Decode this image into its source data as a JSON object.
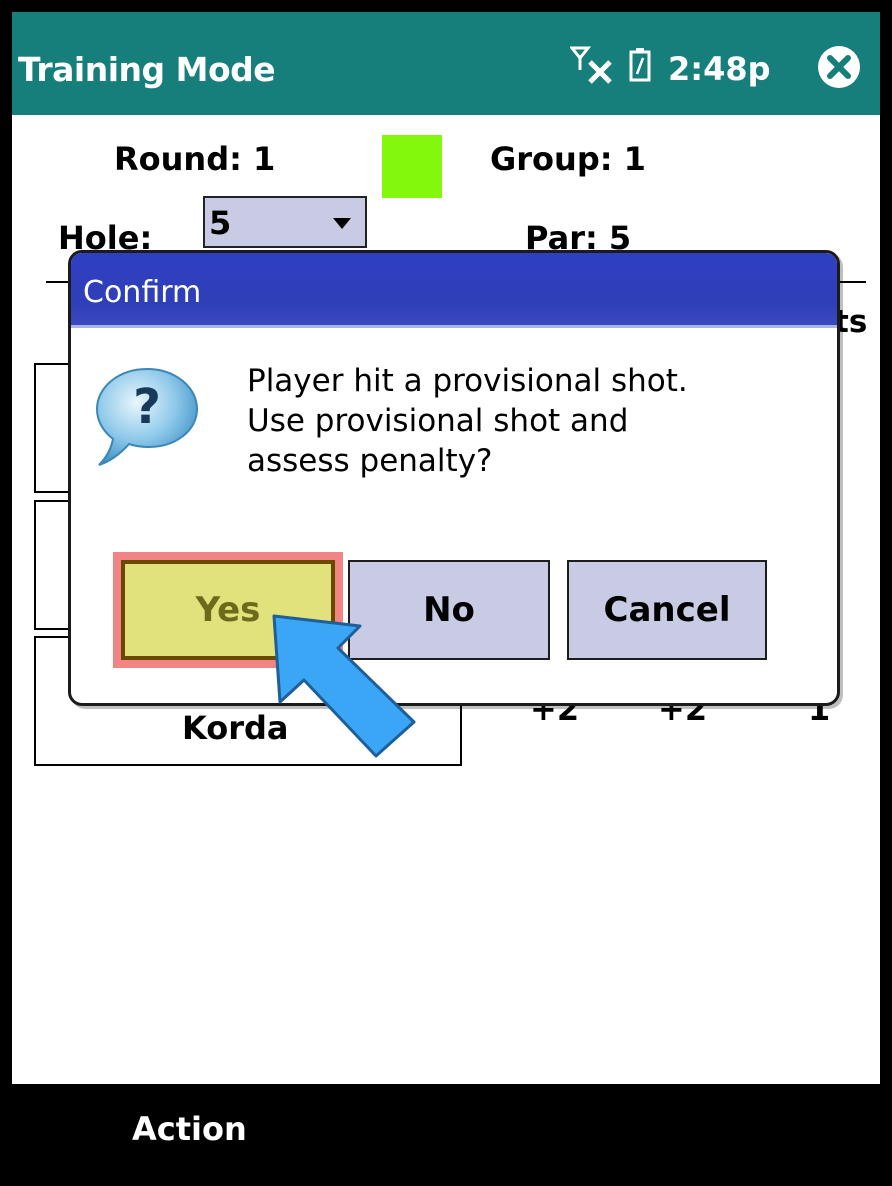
{
  "status_bar": {
    "title": "Training Mode",
    "time": "2:48p",
    "signal_icon": "signal-off-icon",
    "battery_icon": "battery-icon",
    "close_icon": "close-icon"
  },
  "header": {
    "round_label": "Round:  1",
    "group_label": "Group:  1",
    "hole_label": "Hole:",
    "hole_value": "5",
    "par_label": "Par:  5",
    "indicator_color": "#84f80c"
  },
  "table": {
    "pts_fragment": "ts",
    "players": [
      {
        "name": "Korda",
        "scores": [
          "+2",
          "+2",
          "1"
        ]
      }
    ]
  },
  "dialog": {
    "title": "Confirm",
    "icon": "question-icon",
    "message_lines": [
      "Player hit a provisional shot.",
      "Use provisional shot and",
      "assess penalty?"
    ],
    "buttons": {
      "yes": "Yes",
      "no": "No",
      "cancel": "Cancel"
    }
  },
  "footer": {
    "action_label": "Action"
  },
  "colors": {
    "title_bar": "#177f7b",
    "dialog_header": "#2f3fc3",
    "yes_button": "#e2e27c",
    "yes_highlight": "#f18585",
    "button_default": "#c9cbe5",
    "pointer_arrow": "#3aa6f5"
  }
}
